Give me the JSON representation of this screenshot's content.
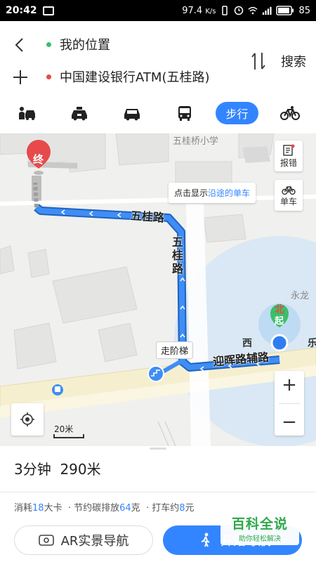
{
  "status_bar": {
    "time": "20:42",
    "speed": "97.4",
    "speed_unit": "K/s",
    "battery": "85"
  },
  "route": {
    "origin": "我的位置",
    "destination": "中国建设银行ATM(五桂路)",
    "search_label": "搜索",
    "origin_dot_color": "#3bbf6a",
    "destination_dot_color": "#e64a4a"
  },
  "modes": {
    "items": [
      "carpool-icon",
      "taxi-icon",
      "car-icon",
      "bus-icon",
      "walk",
      "bike-icon"
    ],
    "active_label": "步行",
    "accent": "#3385ff"
  },
  "map": {
    "report_label": "报错",
    "bike_label": "单车",
    "tooltip_prefix": "点击显示",
    "tooltip_highlight": "沿途的单车",
    "end_marker": "终",
    "start_marker": "起",
    "north_label": "北",
    "stairs_label": "走阶梯",
    "road1": "五桂路",
    "road1_vertical": [
      "五",
      "桂",
      "路"
    ],
    "road2": "迎晖路辅路",
    "poi_school": "五桂桥小学",
    "poi_yonglong": "永龙",
    "side_char_west": "西",
    "side_char_right": "乐",
    "scale": "20米",
    "route_color": "#3f8ef5"
  },
  "summary": {
    "duration": "3分钟",
    "distance": "290米"
  },
  "stats": {
    "calorie_label": "消耗",
    "calorie_value": "18",
    "calorie_unit": "大卡",
    "carbon_label": "节约碳排放",
    "carbon_value": "64",
    "carbon_unit": "克",
    "taxi_label": "打车约",
    "taxi_value": "8",
    "taxi_unit": "元"
  },
  "actions": {
    "ar_label": "AR实景导航",
    "nav_label": "开始导航"
  },
  "watermark": {
    "title": "百科全说",
    "subtitle": "助你轻松解决"
  }
}
